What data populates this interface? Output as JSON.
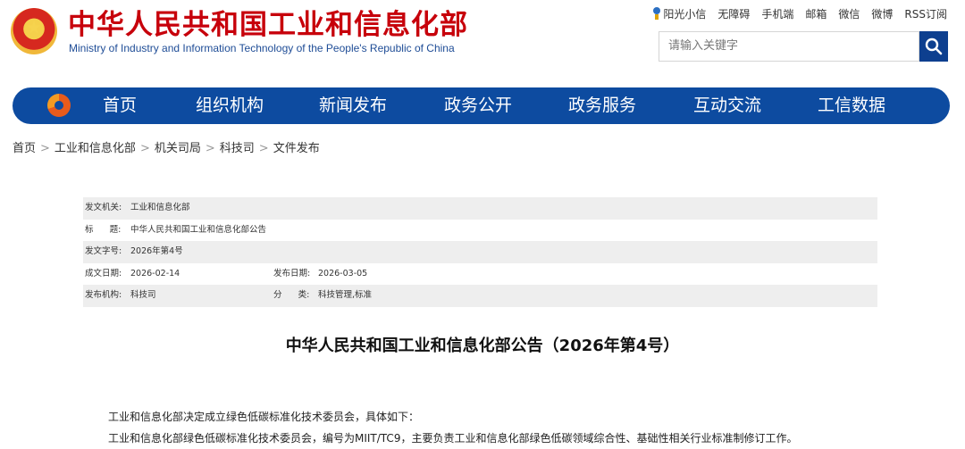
{
  "header": {
    "title": "中华人民共和国工业和信息化部",
    "subtitle": "Ministry of Industry and Information Technology of the People's Republic of China"
  },
  "toplinks": [
    "阳光小信",
    "无障碍",
    "手机端",
    "邮箱",
    "微信",
    "微博",
    "RSS订阅"
  ],
  "search": {
    "placeholder": "请输入关键字"
  },
  "nav": [
    "首页",
    "组织机构",
    "新闻发布",
    "政务公开",
    "政务服务",
    "互动交流",
    "工信数据"
  ],
  "breadcrumb": [
    "首页",
    "工业和信息化部",
    "机关司局",
    "科技司",
    "文件发布"
  ],
  "meta": {
    "issuer_label": "发文机关:",
    "issuer": "工业和信息化部",
    "title_label": "标      题:",
    "title": "中华人民共和国工业和信息化部公告",
    "docno_label": "发文字号:",
    "docno": "2026年第4号",
    "created_label": "成文日期:",
    "created": "2026-02-14",
    "published_label": "发布日期:",
    "published": "2026-03-05",
    "org_label": "发布机构:",
    "org": "科技司",
    "category_label": "分      类:",
    "category": "科技管理,标准"
  },
  "document": {
    "title": "中华人民共和国工业和信息化部公告（2026年第4号）",
    "paragraphs": [
      "工业和信息化部决定成立绿色低碳标准化技术委员会，具体如下：",
      "工业和信息化部绿色低碳标准化技术委员会，编号为MIIT/TC9，主要负责工业和信息化部绿色低碳领域综合性、基础性相关行业标准制修订工作。"
    ]
  }
}
